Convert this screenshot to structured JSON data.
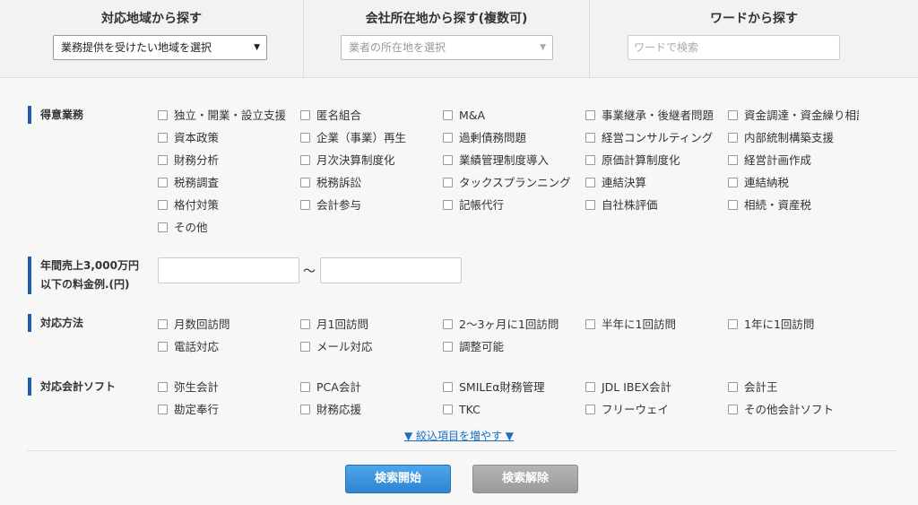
{
  "topbar": {
    "region": {
      "title": "対応地域から探す",
      "select_value": "業務提供を受けたい地域を選択"
    },
    "location": {
      "title": "会社所在地から探す(複数可)",
      "select_value": "業者の所在地を選択"
    },
    "word": {
      "title": "ワードから探す",
      "placeholder": "ワードで検索"
    }
  },
  "specialties": {
    "label": "得意業務",
    "items": [
      "独立・開業・設立支援",
      "匿名組合",
      "M&A",
      "事業継承・後継者問題",
      "資金調達・資金繰り相談",
      "資本政策",
      "企業（事業）再生",
      "過剰債務問題",
      "経営コンサルティング",
      "内部統制構築支援",
      "財務分析",
      "月次決算制度化",
      "業績管理制度導入",
      "原価計算制度化",
      "経営計画作成",
      "税務調査",
      "税務訴訟",
      "タックスプランニング",
      "連結決算",
      "連結納税",
      "格付対策",
      "会計参与",
      "記帳代行",
      "自社株評価",
      "相続・資産税",
      "その他"
    ]
  },
  "fee": {
    "label_line1": "年間売上3,000万円",
    "label_line2": "以下の料金例.(円)",
    "from_value": "",
    "to_value": "",
    "separator": "～"
  },
  "methods": {
    "label": "対応方法",
    "items": [
      "月数回訪問",
      "月1回訪問",
      "2～3ヶ月に1回訪問",
      "半年に1回訪問",
      "1年に1回訪問",
      "電話対応",
      "メール対応",
      "調整可能"
    ]
  },
  "software": {
    "label": "対応会計ソフト",
    "items": [
      "弥生会計",
      "PCA会計",
      "SMILEα財務管理",
      "JDL IBEX会計",
      "会計王",
      "勘定奉行",
      "財務応援",
      "TKC",
      "フリーウェイ",
      "その他会計ソフト"
    ]
  },
  "more_link": "▼ 絞込項目を増やす ▼",
  "buttons": {
    "search": "検索開始",
    "clear": "検索解除"
  },
  "colors": {
    "accent": "#1c5fa8",
    "link": "#1c6fc0",
    "search_button": "#2e84d0",
    "clear_button": "#9a9a9a"
  }
}
